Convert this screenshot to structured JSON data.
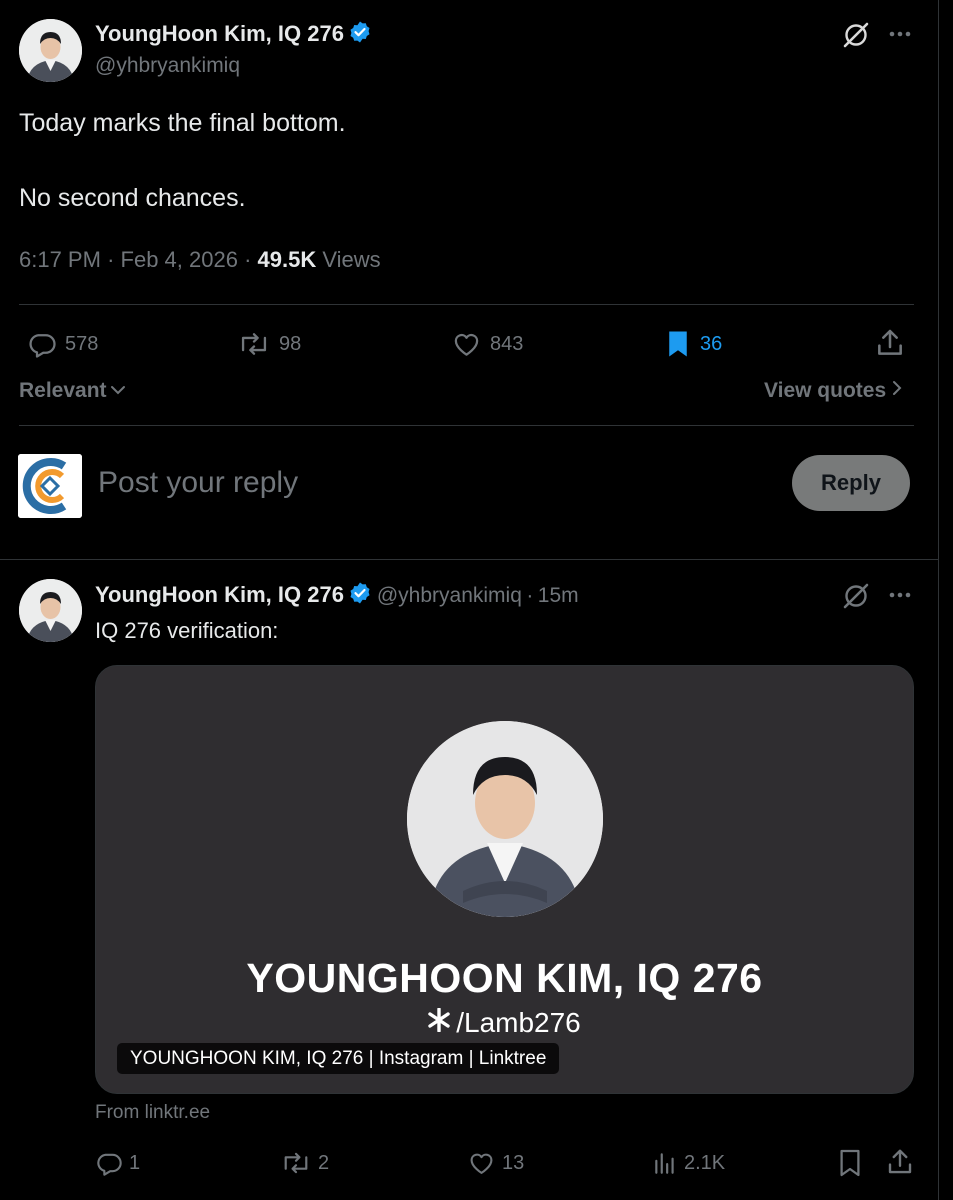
{
  "main_tweet": {
    "author_name": "YoungHoon Kim, IQ 276",
    "author_handle": "@yhbryankimiq",
    "text_line1": "Today marks the final bottom.",
    "text_line2": "No second chances.",
    "time": "6:17 PM",
    "sep1": "·",
    "date": "Feb 4, 2026",
    "sep2": "·",
    "views_count": "49.5K",
    "views_label": "Views",
    "actions": {
      "replies": "578",
      "reposts": "98",
      "likes": "843",
      "bookmarks": "36"
    },
    "bookmark_active_color": "#1d9bf0"
  },
  "sort": {
    "label": "Relevant",
    "view_quotes": "View quotes"
  },
  "composer": {
    "placeholder": "Post your reply",
    "reply_button": "Reply"
  },
  "reply_tweet": {
    "author_name": "YoungHoon Kim, IQ 276",
    "author_handle": "@yhbryankimiq",
    "sep": "·",
    "time_ago": "15m",
    "text": "IQ 276 verification:",
    "card": {
      "headline": "YOUNGHOON KIM, IQ 276",
      "link_path": "/Lamb276",
      "label": "YOUNGHOON KIM, IQ 276 | Instagram | Linktree",
      "source": "From linktr.ee"
    },
    "actions": {
      "replies": "1",
      "reposts": "2",
      "likes": "13",
      "views": "2.1K"
    }
  },
  "icons": {
    "verified": "verified-badge-icon",
    "grok": "grok-icon",
    "more": "more-icon",
    "reply": "reply-icon",
    "repost": "repost-icon",
    "like": "like-icon",
    "bookmark": "bookmark-icon",
    "share": "share-icon",
    "views": "views-icon"
  },
  "colors": {
    "background": "#000000",
    "text": "#e7e9ea",
    "muted": "#71767b",
    "accent": "#1d9bf0",
    "divider": "#2f3336"
  }
}
